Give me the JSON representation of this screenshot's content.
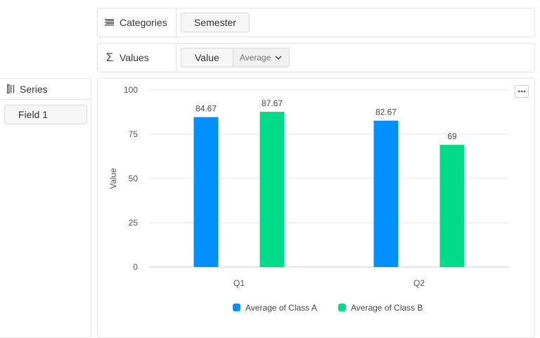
{
  "categories_zone": {
    "label": "Categories",
    "field": "Semester"
  },
  "values_zone": {
    "label": "Values",
    "field": "Value",
    "aggregation": "Average"
  },
  "series_zone": {
    "label": "Series",
    "field": "Field 1"
  },
  "colors": {
    "class_a": "#0090ff",
    "class_b": "#00db8b",
    "grid": "#e6e6e6",
    "axis_text": "#555555"
  },
  "chart_data": {
    "type": "bar",
    "categories": [
      "Q1",
      "Q2"
    ],
    "series": [
      {
        "name": "Average of Class A",
        "values": [
          84.67,
          82.67
        ]
      },
      {
        "name": "Average of Class B",
        "values": [
          87.67,
          69
        ]
      }
    ],
    "value_labels": [
      [
        "84.67",
        "82.67"
      ],
      [
        "87.67",
        "69"
      ]
    ],
    "ylabel": "Value",
    "xlabel": "",
    "ylim": [
      0,
      100
    ],
    "yticks": [
      0,
      25,
      50,
      75,
      100
    ],
    "grid": true,
    "legend_position": "bottom-center"
  }
}
